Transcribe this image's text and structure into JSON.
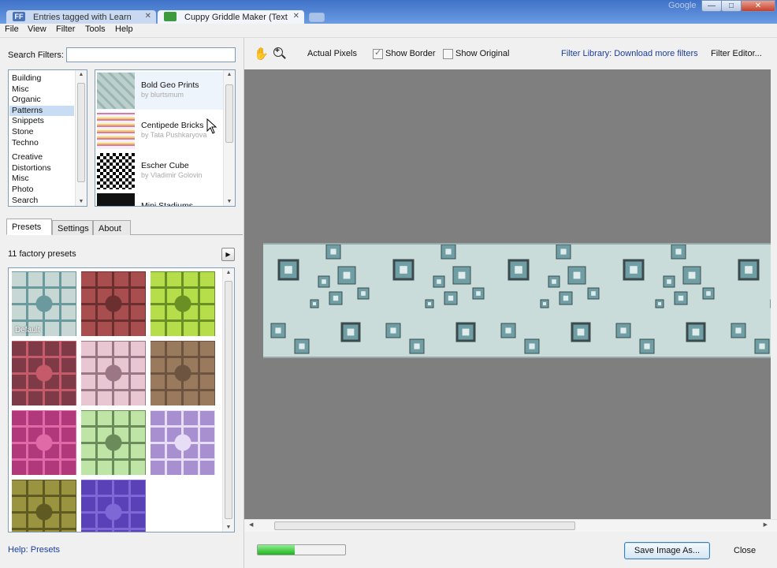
{
  "browser": {
    "tabs": [
      {
        "title": "Entries tagged with Learn",
        "favicon": "FF"
      },
      {
        "title": "Cuppy Griddle Maker (Text"
      }
    ],
    "brand": "Google",
    "window_buttons": [
      "minimize",
      "maximize",
      "close"
    ]
  },
  "menubar": {
    "items": [
      "File",
      "View",
      "Filter",
      "Tools",
      "Help"
    ]
  },
  "filters": {
    "search_label": "Search Filters:",
    "search_value": "",
    "categories": [
      {
        "label": "Building",
        "selected": false
      },
      {
        "label": "Misc",
        "selected": false
      },
      {
        "label": "Organic",
        "selected": false
      },
      {
        "label": "Patterns",
        "selected": true
      },
      {
        "label": "Snippets",
        "selected": false
      },
      {
        "label": "Stone",
        "selected": false
      },
      {
        "label": "Techno",
        "selected": false
      },
      {
        "label": "Creative",
        "selected": false
      },
      {
        "label": "Distortions",
        "selected": false
      },
      {
        "label": "Misc",
        "selected": false
      },
      {
        "label": "Photo",
        "selected": false
      },
      {
        "label": "Search",
        "selected": false
      }
    ],
    "items": [
      {
        "name": "Bold Geo Prints",
        "author": "by blurtsmum",
        "selected": true
      },
      {
        "name": "Centipede Bricks",
        "author": "by Tata Pushkaryova",
        "selected": false
      },
      {
        "name": "Escher Cube",
        "author": "by Vladimir Golovin",
        "selected": false
      },
      {
        "name": "Mini Stadiums",
        "author": "",
        "selected": false
      }
    ]
  },
  "panel_tabs": [
    {
      "label": "Presets",
      "active": true
    },
    {
      "label": "Settings",
      "active": false
    },
    {
      "label": "About",
      "active": false
    }
  ],
  "presets": {
    "count_label": "11 factory presets",
    "default_label": "Default",
    "play_icon": "play-icon",
    "swatches": [
      {
        "base": "#c7d8d4",
        "accent": "#6a9a9e"
      },
      {
        "base": "#a84e4e",
        "accent": "#6b2f2f"
      },
      {
        "base": "#b6dd4a",
        "accent": "#6a8f24"
      },
      {
        "base": "#7e3b47",
        "accent": "#c45a6a"
      },
      {
        "base": "#e8c6d2",
        "accent": "#9b7685"
      },
      {
        "base": "#9a7a5c",
        "accent": "#6c5440"
      },
      {
        "base": "#b1397b",
        "accent": "#e06aa8"
      },
      {
        "base": "#bfe5a6",
        "accent": "#6b8c5a"
      },
      {
        "base": "#a88fcf",
        "accent": "#e7ddf6"
      },
      {
        "base": "#9a9441",
        "accent": "#5f5a22"
      },
      {
        "base": "#5a41b8",
        "accent": "#7e68d6"
      }
    ]
  },
  "help_link": "Help: Presets",
  "toolbar": {
    "hand_icon": "hand-icon",
    "zoom_icon": "zoom-icon",
    "actual_pixels": "Actual Pixels",
    "show_border": {
      "label": "Show Border",
      "checked": true
    },
    "show_original": {
      "label": "Show Original",
      "checked": false
    },
    "filter_library": "Filter Library: Download more filters",
    "filter_editor": "Filter Editor..."
  },
  "progress": {
    "value": 0.42
  },
  "buttons": {
    "save": "Save Image As...",
    "close": "Close"
  },
  "colors": {
    "canvas_bg": "#7f7f7f",
    "tile_bg": "#c9dcd9",
    "tile_accent": "#6f9ea4",
    "link": "#1a3e9e"
  }
}
